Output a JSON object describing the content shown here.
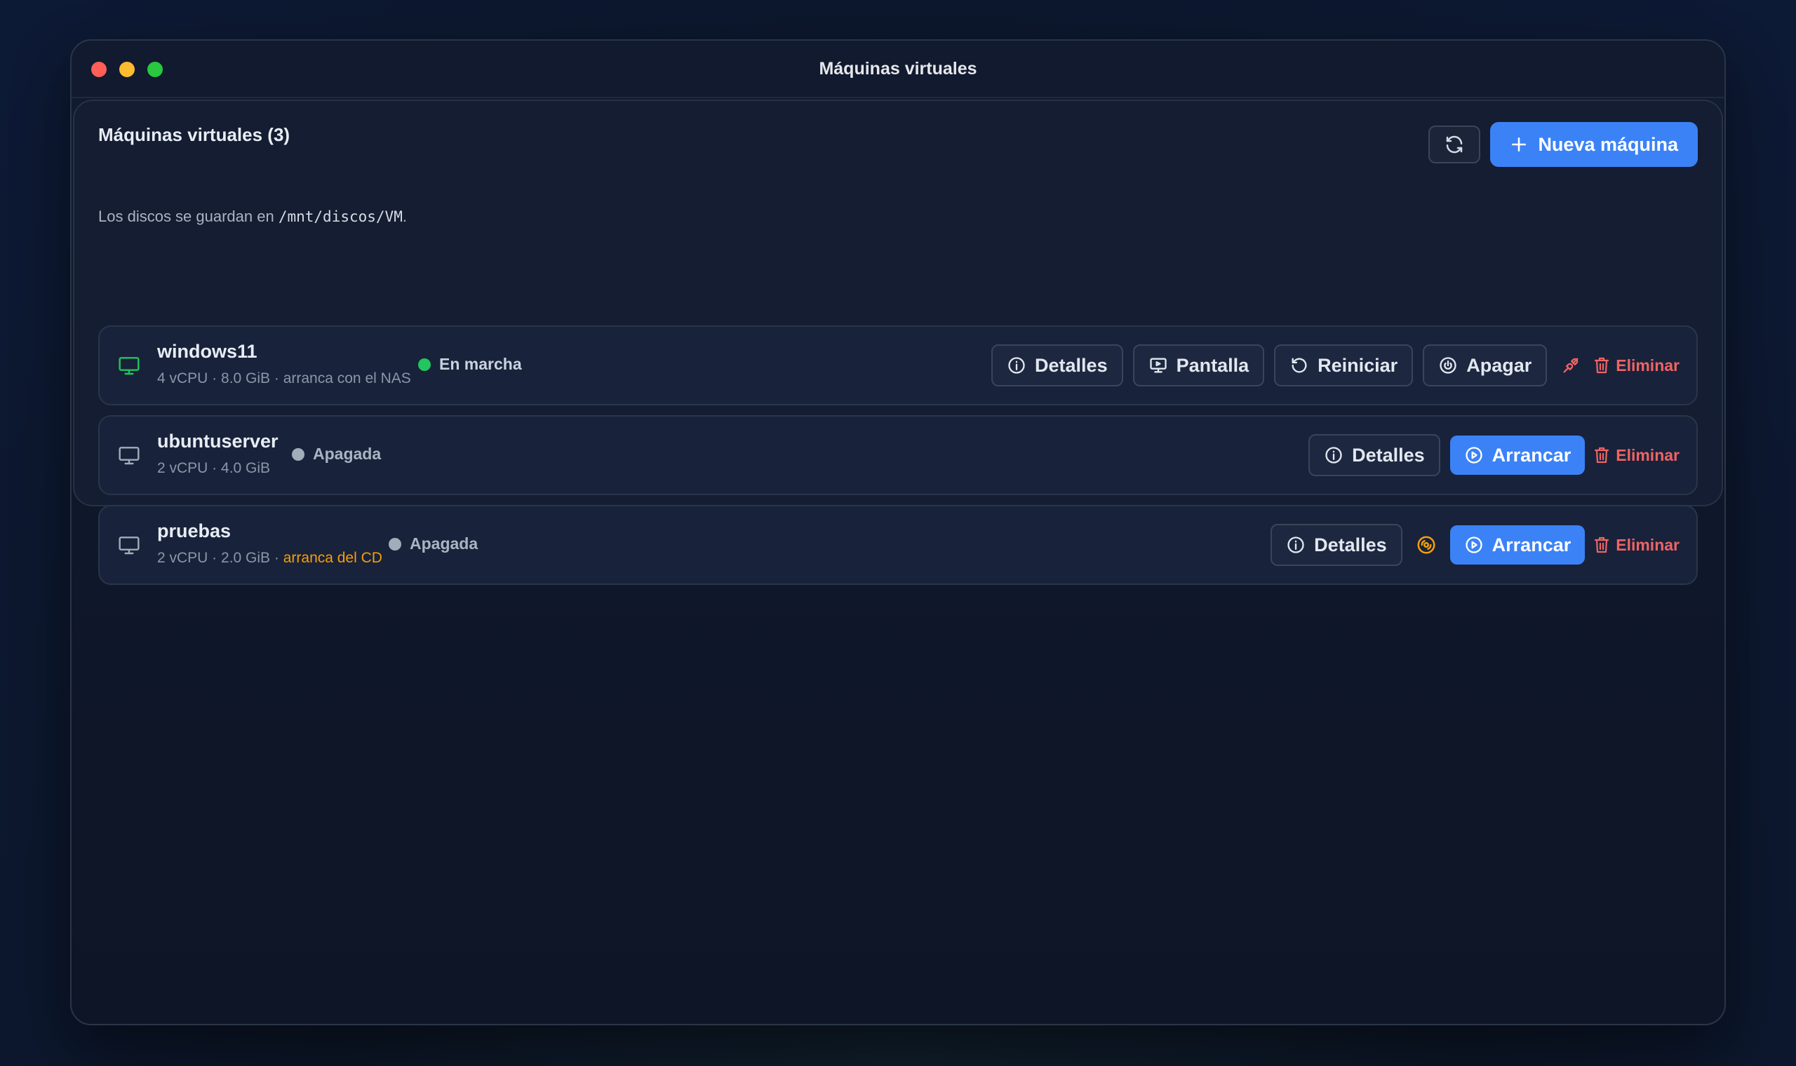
{
  "window": {
    "title": "Máquinas virtuales"
  },
  "panel": {
    "title": "Máquinas virtuales (3)",
    "new_vm_label": "Nueva máquina",
    "storage_prefix": "Los discos se guardan en ",
    "storage_path": "/mnt/discos/VM",
    "storage_suffix": "."
  },
  "vms": [
    {
      "name": "windows11",
      "meta": "4 vCPU · 8.0 GiB · arranca con el NAS",
      "status": "En marcha",
      "actions": {
        "details": "Detalles",
        "screen": "Pantalla",
        "restart": "Reiniciar",
        "shutdown": "Apagar",
        "delete": "Eliminar"
      }
    },
    {
      "name": "ubuntuserver",
      "meta": "2 vCPU · 4.0 GiB",
      "status": "Apagada",
      "actions": {
        "details": "Detalles",
        "start": "Arrancar",
        "delete": "Eliminar"
      }
    },
    {
      "name": "pruebas",
      "meta_main": "2 vCPU · 2.0 GiB · ",
      "meta_warn": "arranca del CD",
      "status": "Apagada",
      "actions": {
        "details": "Detalles",
        "start": "Arrancar",
        "delete": "Eliminar"
      }
    }
  ],
  "colors": {
    "accent": "#3b82f6",
    "running": "#22c55e",
    "stopped": "#a3acb9",
    "danger": "#f06464",
    "warning": "#f59e0b"
  }
}
